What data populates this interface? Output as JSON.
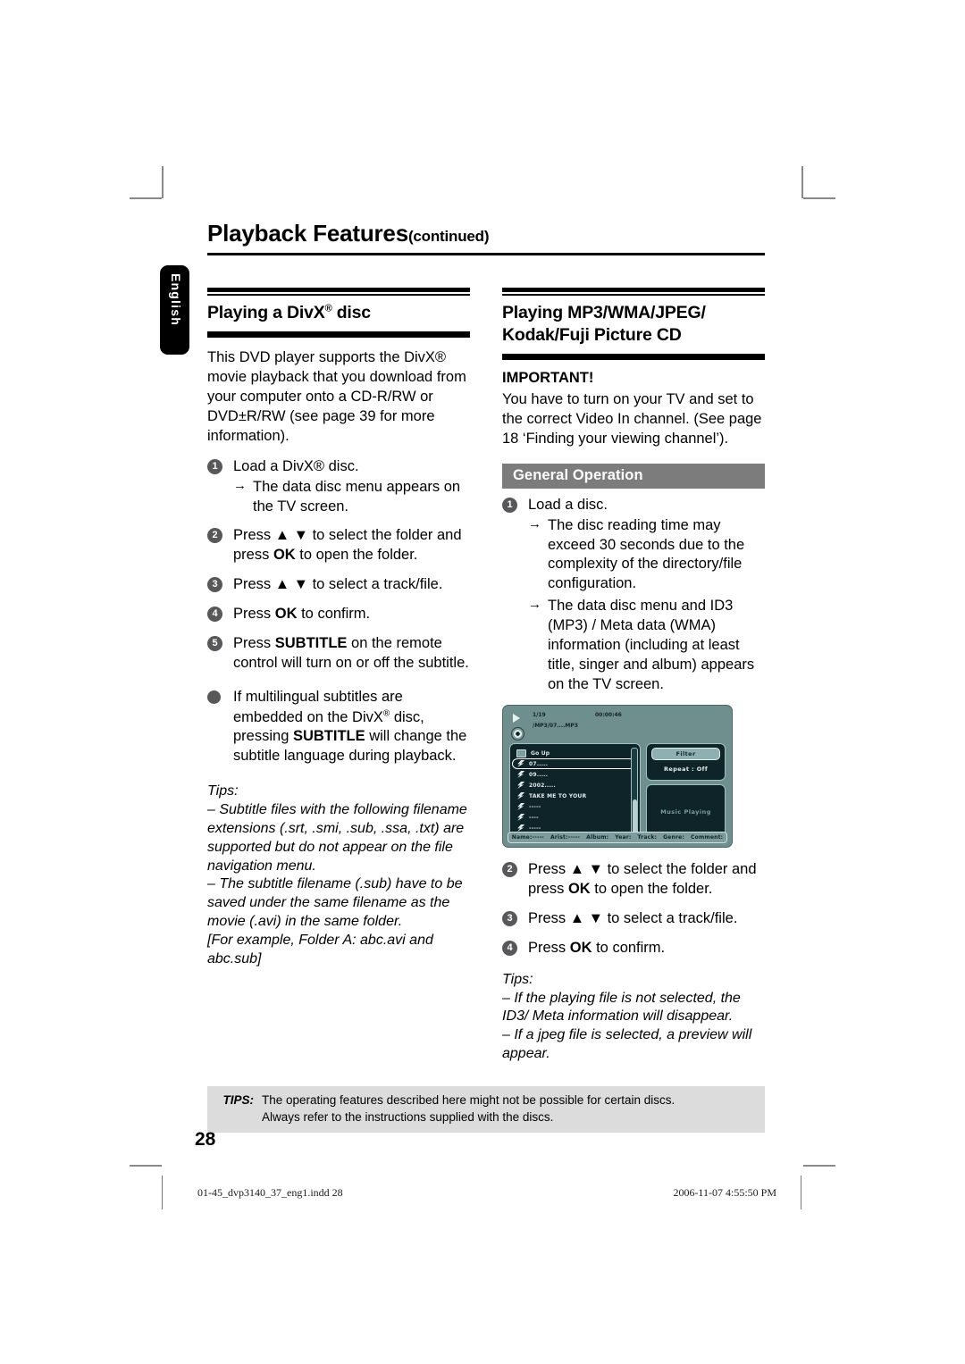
{
  "running_head": {
    "title": "Playback Features",
    "continued": "(continued)"
  },
  "language_tab": "English",
  "left_column": {
    "heading": "Playing a DivX",
    "heading_sup": "®",
    "heading_tail": " disc",
    "intro": "This DVD player supports the DivX® movie playback that you download from your computer onto a CD-R/RW or DVD±R/RW (see page 39 for more information).",
    "steps": [
      {
        "num": "1",
        "text": "Load a DivX® disc.",
        "sub": "The data disc menu appears on the TV screen."
      },
      {
        "num": "2",
        "text": "Press ▲ ▼ to select the folder and press OK to open the folder."
      },
      {
        "num": "3",
        "text": "Press ▲ ▼ to select a track/file."
      },
      {
        "num": "4",
        "text": "Press OK to confirm."
      },
      {
        "num": "5",
        "text": "Press SUBTITLE on the remote control will turn on or off the subtitle."
      }
    ],
    "bullet": "If multilingual subtitles are embedded on the DivX® disc, pressing SUBTITLE will change the subtitle language during playback.",
    "tips_label": "Tips:",
    "tips": [
      "– Subtitle files with the following filename extensions (.srt, .smi, .sub, .ssa, .txt) are supported but do not appear on the file navigation menu.",
      "– The subtitle filename (.sub) have to be saved under the same filename as the movie (.avi) in the same folder.",
      "[For example, Folder A: abc.avi and abc.sub]"
    ]
  },
  "right_column": {
    "heading_line1": "Playing MP3/WMA/JPEG/",
    "heading_line2": "Kodak/Fuji Picture CD",
    "important_label": "IMPORTANT!",
    "important_text": "You have to turn on your TV and set to the correct Video In channel.  (See page 18 ‘Finding your viewing channel’).",
    "subsection": "General Operation",
    "steps_top": [
      {
        "num": "1",
        "text": "Load a disc.",
        "subs": [
          "The disc reading time may exceed 30 seconds due to the complexity of the directory/file configuration.",
          "The data disc menu and ID3 (MP3) / Meta data (WMA) information (including at least title, singer and album) appears on the TV screen."
        ]
      }
    ],
    "steps_bottom": [
      {
        "num": "2",
        "text": "Press ▲ ▼ to select the folder and press OK to open the folder."
      },
      {
        "num": "3",
        "text": "Press ▲ ▼ to select a track/file."
      },
      {
        "num": "4",
        "text": "Press OK to confirm."
      }
    ],
    "tips_label": "Tips:",
    "tips": [
      "– If the playing file is not selected, the ID3/ Meta information will disappear.",
      "– If a jpeg file is selected, a preview will appear."
    ]
  },
  "screenshot": {
    "track_index": "1/19",
    "elapsed_time": "00:00:46",
    "path": "/MP3/07....MP3",
    "list": [
      {
        "icon": "folder-icon",
        "label": "Go Up",
        "selected": false
      },
      {
        "icon": "music-note-icon",
        "label": "07.....",
        "selected": true
      },
      {
        "icon": "music-note-icon",
        "label": "09.....",
        "selected": false
      },
      {
        "icon": "music-note-icon",
        "label": "2002.....",
        "selected": false
      },
      {
        "icon": "music-note-icon",
        "label": "TAKE ME TO YOUR",
        "selected": false
      },
      {
        "icon": "music-note-icon",
        "label": "-----",
        "selected": false
      },
      {
        "icon": "music-note-icon",
        "label": "----",
        "selected": false
      },
      {
        "icon": "music-note-icon",
        "label": "-----",
        "selected": false
      }
    ],
    "filter_button": "Filter",
    "repeat_status": "Repeat : Off",
    "playing_status": "Music Playing",
    "status_fields": [
      "Name:-----",
      "Arist:-----",
      "Album:",
      "Year:",
      "Track:",
      "Genre:",
      "Comment:"
    ],
    "colors": {
      "background": "#6f8e8e",
      "panel": "#0e2429",
      "accent": "#8fb0b0"
    }
  },
  "footer": {
    "tips_label": "TIPS:",
    "tips_line1": "The operating features described here might not be possible for certain discs.",
    "tips_line2": "Always refer to the instructions supplied with the discs.",
    "page_number": "28"
  },
  "print_footer": {
    "filename": "01-45_dvp3140_37_eng1.indd   28",
    "datetime": "2006-11-07   4:55:50 PM"
  }
}
